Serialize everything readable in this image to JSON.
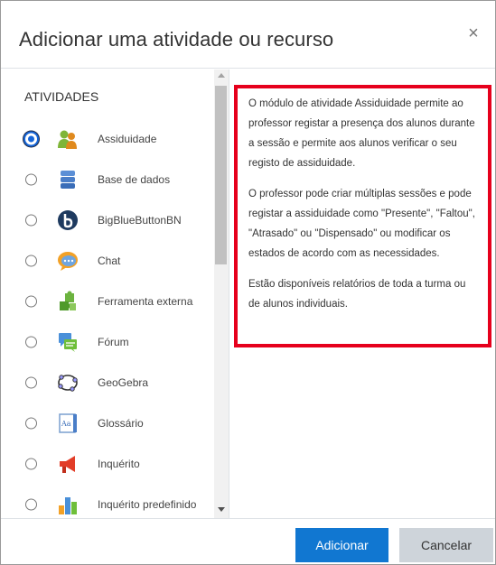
{
  "dialog": {
    "title": "Adicionar uma atividade ou recurso",
    "close_glyph": "×"
  },
  "activities": {
    "heading": "ATIVIDADES",
    "selected_index": 0,
    "items": [
      {
        "label": "Assiduidade",
        "icon": "attendance-icon"
      },
      {
        "label": "Base de dados",
        "icon": "database-icon"
      },
      {
        "label": "BigBlueButtonBN",
        "icon": "bigbluebutton-icon"
      },
      {
        "label": "Chat",
        "icon": "chat-icon"
      },
      {
        "label": "Ferramenta externa",
        "icon": "puzzle-icon"
      },
      {
        "label": "Fórum",
        "icon": "forum-icon"
      },
      {
        "label": "GeoGebra",
        "icon": "geogebra-icon"
      },
      {
        "label": "Glossário",
        "icon": "glossary-icon"
      },
      {
        "label": "Inquérito",
        "icon": "megaphone-icon"
      },
      {
        "label": "Inquérito predefinido",
        "icon": "bar-chart-icon"
      }
    ]
  },
  "description": {
    "paragraphs": [
      "O módulo de atividade Assiduidade permite ao professor registar a presença dos alunos durante a sessão e permite aos alunos verificar o seu registo de assiduidade.",
      "O professor pode criar múltiplas sessões e pode registar a assiduidade como \"Presente\", \"Faltou\", \"Atrasado\" ou \"Dispensado\" ou modificar os estados de acordo com as necessidades.",
      "Estão disponíveis relatórios de toda a turma ou de alunos individuais."
    ]
  },
  "footer": {
    "add_label": "Adicionar",
    "cancel_label": "Cancelar"
  },
  "colors": {
    "primary": "#1177d1",
    "highlight_border": "#e6001c"
  }
}
